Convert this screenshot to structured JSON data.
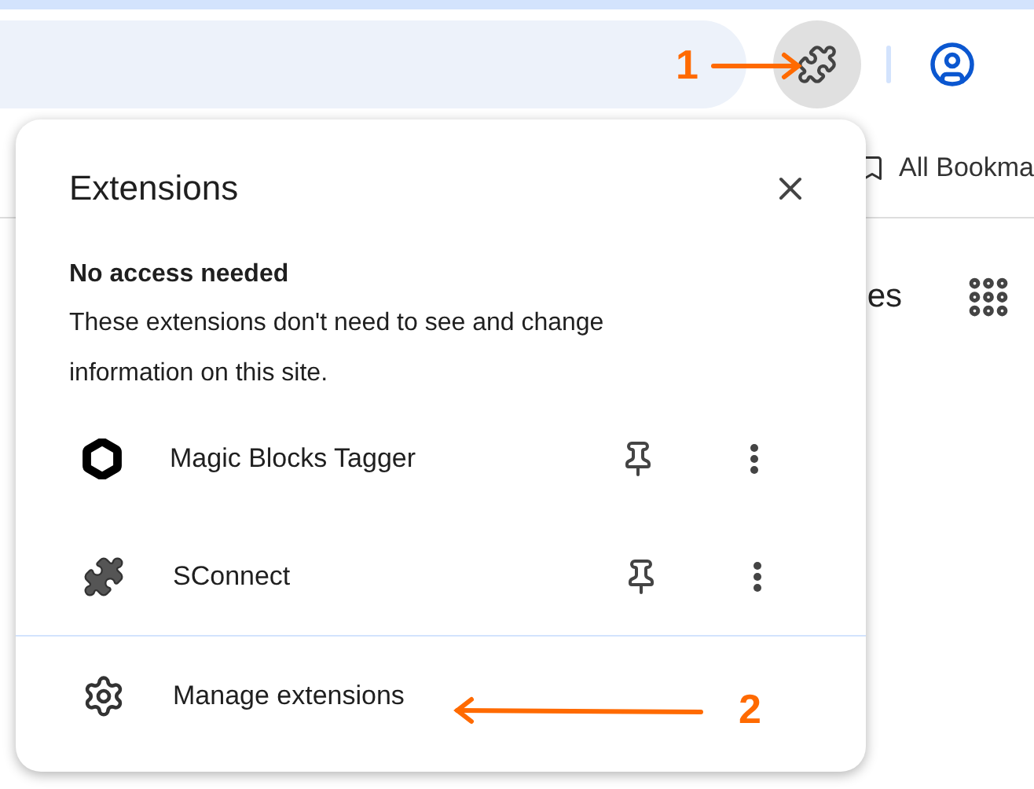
{
  "browser": {
    "bookmarks_bar_item": "All Bookma",
    "page_text": "es"
  },
  "popup": {
    "title": "Extensions",
    "section_title": "No access needed",
    "section_text": "These extensions don't need to see and change information on this site.",
    "extensions": [
      {
        "name": "Magic Blocks Tagger",
        "kind": "hexagon",
        "pinned": false
      },
      {
        "name": "SConnect",
        "kind": "puzzle",
        "pinned": false
      }
    ],
    "manage_label": "Manage extensions"
  },
  "annotations": [
    {
      "label": "1",
      "kind": "right"
    },
    {
      "label": "2",
      "kind": "left"
    }
  ]
}
